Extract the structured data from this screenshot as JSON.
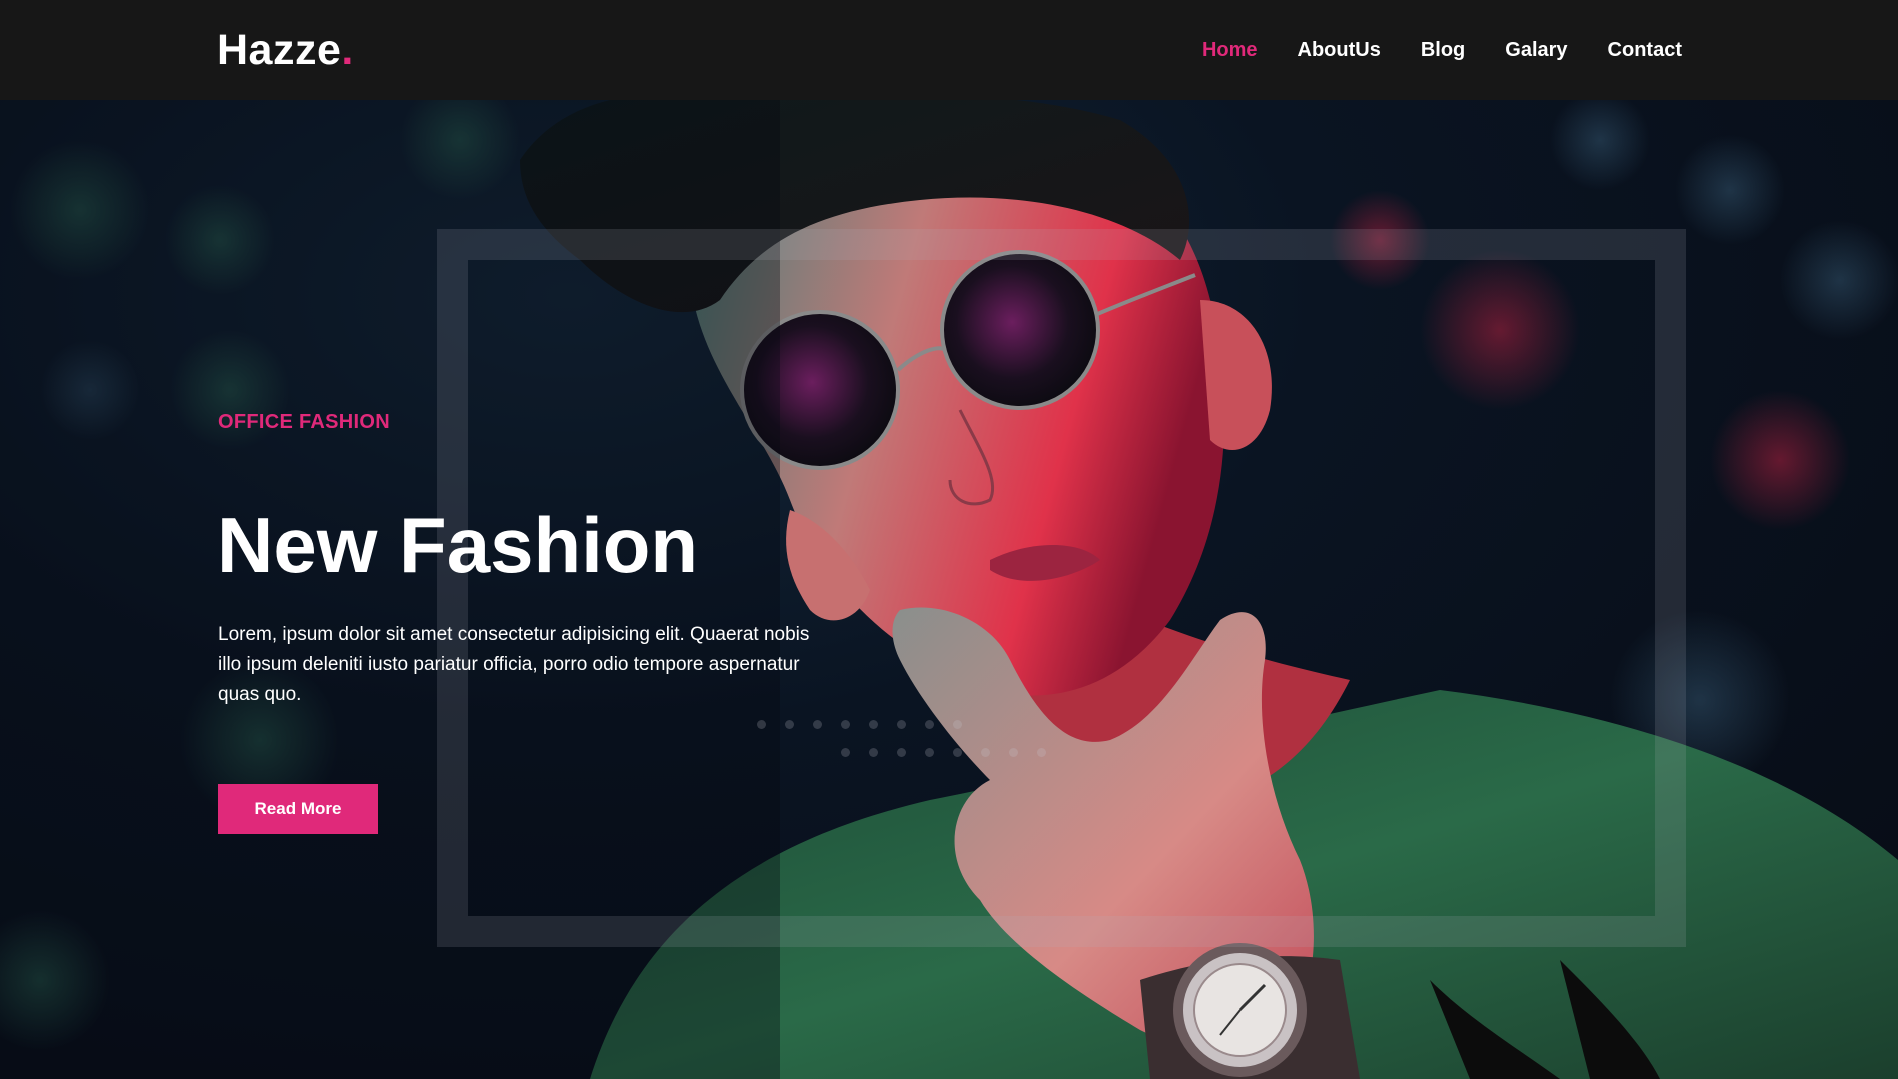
{
  "brand": {
    "name": "Hazze",
    "dot": ".",
    "accent_color": "#e0297a"
  },
  "nav": {
    "items": [
      {
        "label": "Home",
        "active": true
      },
      {
        "label": "AboutUs",
        "active": false
      },
      {
        "label": "Blog",
        "active": false
      },
      {
        "label": "Galary",
        "active": false
      },
      {
        "label": "Contact",
        "active": false
      }
    ]
  },
  "hero": {
    "subtitle": "OFFICE FASHION",
    "title": "New Fashion",
    "description": "Lorem, ipsum dolor sit amet consectetur adipisicing elit. Quaerat nobis illo ipsum deleniti iusto pariatur officia, porro odio tempore aspernatur quas quo.",
    "button_label": "Read More",
    "image_subject": "man-with-sunglasses-photo"
  }
}
